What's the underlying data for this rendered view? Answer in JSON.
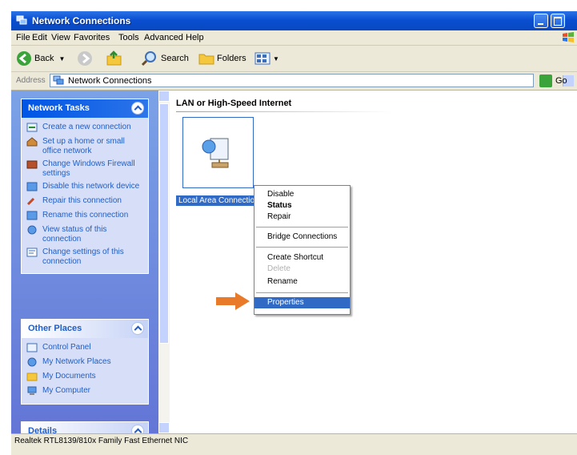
{
  "window": {
    "title": "Network Connections"
  },
  "menubar": {
    "items": [
      "File",
      "Edit",
      "View",
      "Favorites",
      "Tools",
      "Advanced",
      "Help"
    ]
  },
  "toolbar": {
    "back_label": "Back",
    "search_label": "Search",
    "folders_label": "Folders"
  },
  "address": {
    "label": "Address",
    "value": "Network Connections",
    "go_label": "Go"
  },
  "sidebar": {
    "network_tasks": {
      "title": "Network Tasks",
      "items": [
        {
          "label": "Create a new connection",
          "icon": "new-connection-icon"
        },
        {
          "label": "Set up a home or small office network",
          "icon": "home-network-icon"
        },
        {
          "label": "Change Windows Firewall settings",
          "icon": "firewall-icon"
        },
        {
          "label": "Disable this network device",
          "icon": "disable-device-icon"
        },
        {
          "label": "Repair this connection",
          "icon": "repair-icon"
        },
        {
          "label": "Rename this connection",
          "icon": "rename-icon"
        },
        {
          "label": "View status of this connection",
          "icon": "status-icon"
        },
        {
          "label": "Change settings of this connection",
          "icon": "settings-icon"
        }
      ]
    },
    "other_places": {
      "title": "Other Places",
      "items": [
        {
          "label": "Control Panel",
          "icon": "control-panel-icon"
        },
        {
          "label": "My Network Places",
          "icon": "network-places-icon"
        },
        {
          "label": "My Documents",
          "icon": "documents-icon"
        },
        {
          "label": "My Computer",
          "icon": "computer-icon"
        }
      ]
    },
    "details": {
      "title": "Details"
    }
  },
  "content": {
    "group_header": "LAN or High-Speed Internet",
    "connection_label": "Local Area Connection"
  },
  "context_menu": {
    "items": [
      {
        "label": "Disable",
        "style": "normal"
      },
      {
        "label": "Status",
        "style": "bold"
      },
      {
        "label": "Repair",
        "style": "normal"
      },
      {
        "label": "Bridge Connections",
        "style": "normal"
      },
      {
        "label": "Create Shortcut",
        "style": "normal"
      },
      {
        "label": "Delete",
        "style": "disabled"
      },
      {
        "label": "Rename",
        "style": "normal"
      },
      {
        "label": "Properties",
        "style": "selected"
      }
    ]
  },
  "statusbar": {
    "text": "Realtek RTL8139/810x Family Fast Ethernet NIC"
  },
  "colors": {
    "title_blue": "#0a4fd1",
    "selection_blue": "#316ac5",
    "arrow_orange": "#e87a2a"
  }
}
